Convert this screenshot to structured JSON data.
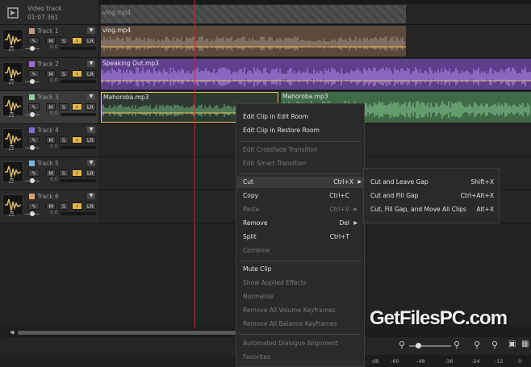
{
  "video_track": {
    "name": "Video track",
    "time": "01:07.361",
    "clip": "vlog.mp4"
  },
  "tracks": [
    {
      "name": "Track 1",
      "color": "#c49a80",
      "mute": "M",
      "solo": "S",
      "lr": "LR",
      "volume": "0.0",
      "clip": "vlog.mp4"
    },
    {
      "name": "Track 2",
      "color": "#9a6ed8",
      "mute": "M",
      "solo": "S",
      "lr": "LR",
      "volume": "0.0",
      "clip": "Speaking Out.mp3"
    },
    {
      "name": "Track 3",
      "color": "#8fcf9a",
      "mute": "M",
      "solo": "S",
      "lr": "LR",
      "volume": "0.0",
      "clip": "Mahoroba.mp3",
      "clip2": "Mahoroba.mp3"
    },
    {
      "name": "Track 4",
      "color": "#7a6ed8",
      "mute": "M",
      "solo": "S",
      "lr": "LR",
      "volume": "0.0"
    },
    {
      "name": "Track 5",
      "color": "#7ab8e0",
      "mute": "M",
      "solo": "S",
      "lr": "LR",
      "volume": "0.0"
    },
    {
      "name": "Track 6",
      "color": "#e0a070",
      "mute": "M",
      "solo": "S",
      "lr": "LR",
      "volume": "0.0"
    }
  ],
  "context_menu": {
    "edit_in_edit_room": "Edit Clip in Edit Room",
    "edit_in_restore_room": "Edit Clip in Restore Room",
    "edit_crossfade": "Edit Crossfade Transition",
    "edit_smart": "Edit Smart Transition",
    "cut": "Cut",
    "cut_sc": "Ctrl+X",
    "copy": "Copy",
    "copy_sc": "Ctrl+C",
    "paste": "Paste",
    "paste_sc": "Ctrl+V",
    "remove": "Remove",
    "remove_sc": "Del",
    "split": "Split",
    "split_sc": "Ctrl+T",
    "combine": "Combine",
    "mute_clip": "Mute Clip",
    "show_effects": "Show Applied Effects",
    "normalize": "Normalize",
    "remove_volume_kf": "Remove All Volume Keyframes",
    "remove_balance_kf": "Remove All Balance Keyframes",
    "auto_dialogue": "Automated Dialogue Alignment",
    "favorites": "Favorites"
  },
  "submenu": {
    "leave_gap": "Cut and Leave Gap",
    "leave_gap_sc": "Shift+X",
    "fill_gap": "Cut and Fill Gap",
    "fill_gap_sc": "Ctrl+Alt+X",
    "fill_move": "Cut, Fill Gap, and Move All Clips",
    "fill_move_sc": "Alt+X"
  },
  "meter_scale": {
    "unit": "dB",
    "ticks": [
      "-60",
      "-48",
      "-36",
      "-24",
      "-12",
      "0"
    ]
  },
  "watermark": "GetFilesPC.com",
  "colors": {
    "accent": "#e6b84a",
    "playhead": "#d02020"
  }
}
